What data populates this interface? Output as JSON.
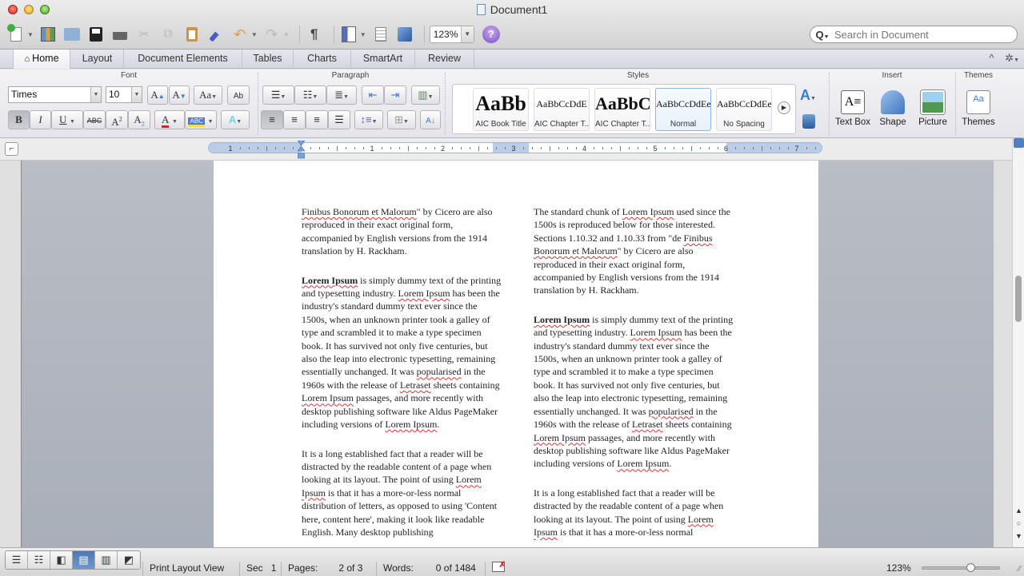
{
  "window": {
    "title": "Document1"
  },
  "toolbar": {
    "buttons": [
      "new-document",
      "templates",
      "open",
      "save",
      "print",
      "cut",
      "copy",
      "paste",
      "format-painter",
      "undo",
      "redo",
      "show-formatting",
      "sidebar",
      "gallery",
      "media-browser"
    ],
    "zoom_value": "123%",
    "help_label": "?"
  },
  "search": {
    "placeholder": "Search in Document"
  },
  "ribbon_tabs": [
    {
      "label": "Home",
      "active": true
    },
    {
      "label": "Layout",
      "active": false
    },
    {
      "label": "Document Elements",
      "active": false
    },
    {
      "label": "Tables",
      "active": false
    },
    {
      "label": "Charts",
      "active": false
    },
    {
      "label": "SmartArt",
      "active": false
    },
    {
      "label": "Review",
      "active": false
    }
  ],
  "ribbon": {
    "groups": {
      "font": "Font",
      "paragraph": "Paragraph",
      "styles": "Styles",
      "insert": "Insert",
      "themes": "Themes"
    },
    "font_name": "Times",
    "font_size": "10",
    "bold_label": "B",
    "italic_label": "I",
    "underline_label": "U",
    "strike_label": "ABC",
    "styles": [
      {
        "sample": "AaBb",
        "name": "AIC Book Title",
        "selected": false
      },
      {
        "sample": "AaBbCcDdE",
        "name": "AIC Chapter T...",
        "selected": false
      },
      {
        "sample": "AaBbC",
        "name": "AIC Chapter T...",
        "selected": false
      },
      {
        "sample": "AaBbCcDdEe",
        "name": "Normal",
        "selected": true
      },
      {
        "sample": "AaBbCcDdEe",
        "name": "No Spacing",
        "selected": false
      }
    ],
    "insert_buttons": [
      "Text Box",
      "Shape",
      "Picture"
    ],
    "themes_button": "Themes"
  },
  "ruler": {
    "numbers": [
      "1",
      "1",
      "2",
      "3",
      "4",
      "5",
      "6",
      "7"
    ]
  },
  "document": {
    "left_column": [
      {
        "segments": [
          {
            "t": "Finibus Bonorum et Malorum",
            "sp": true
          },
          {
            "t": "\" by Cicero are also reproduced in their exact original form, accompanied by English versions from the 1914 translation by H. Rackham."
          }
        ]
      },
      {
        "segments": [
          {
            "t": "Lorem Ipsum",
            "b": true,
            "sp": true
          },
          {
            "t": " is simply dummy text of the printing and typesetting industry. "
          },
          {
            "t": "Lorem Ipsum",
            "sp": true
          },
          {
            "t": " has been the industry's standard dummy text ever since the 1500s, when an unknown printer took a galley of type and scrambled it to make a type specimen book. It has survived not only five centuries, but also the leap into electronic typesetting, remaining essentially unchanged. It was "
          },
          {
            "t": "popularised",
            "sp": true
          },
          {
            "t": " in the 1960s with the release of "
          },
          {
            "t": "Letraset",
            "sp": true
          },
          {
            "t": " sheets containing "
          },
          {
            "t": "Lorem Ipsum",
            "sp": true
          },
          {
            "t": " passages, and more recently with desktop publishing software like Aldus PageMaker including versions of "
          },
          {
            "t": "Lorem Ipsum",
            "sp": true
          },
          {
            "t": "."
          }
        ]
      },
      {
        "segments": [
          {
            "t": "It is a long established fact that a reader will be distracted by the readable content of a page when looking at its layout. The point of using "
          },
          {
            "t": "Lorem Ipsum",
            "sp": true
          },
          {
            "t": " is that it has a more-or-less normal distribution of letters, as opposed to using 'Content here, content here', making it look like readable English. Many desktop publishing"
          }
        ]
      }
    ],
    "right_column": [
      {
        "segments": [
          {
            "t": "The standard chunk of "
          },
          {
            "t": "Lorem Ipsum",
            "sp": true
          },
          {
            "t": " used since the 1500s is reproduced below for those interested. Sections 1.10.32 and 1.10.33 from \"de "
          },
          {
            "t": "Finibus Bonorum et Malorum",
            "sp": true
          },
          {
            "t": "\" by Cicero are also reproduced in their exact original form, accompanied by English versions from the 1914 translation by H. Rackham."
          }
        ]
      },
      {
        "segments": [
          {
            "t": "Lorem Ipsum",
            "b": true,
            "sp": true
          },
          {
            "t": " is simply dummy text of the printing and typesetting industry. "
          },
          {
            "t": "Lorem Ipsum",
            "sp": true
          },
          {
            "t": " has been the industry's standard dummy text ever since the 1500s, when an unknown printer took a galley of type and scrambled it to make a type specimen book. It has survived not only five centuries, but also the leap into electronic typesetting, remaining essentially unchanged. It was "
          },
          {
            "t": "popularised",
            "sp": true
          },
          {
            "t": " in the 1960s with the release of "
          },
          {
            "t": "Letraset",
            "sp": true
          },
          {
            "t": " sheets containing "
          },
          {
            "t": "Lorem Ipsum",
            "sp": true
          },
          {
            "t": " passages, and more recently with desktop publishing software like Aldus PageMaker including versions of "
          },
          {
            "t": "Lorem Ipsum",
            "sp": true
          },
          {
            "t": "."
          }
        ]
      },
      {
        "segments": [
          {
            "t": "It is a long established fact that a reader will be distracted by the readable content of a page when looking at its layout. The point of using "
          },
          {
            "t": "Lorem Ipsum",
            "sp": true
          },
          {
            "t": " is that it has a more-or-less normal"
          }
        ]
      }
    ]
  },
  "statusbar": {
    "view_name": "Print Layout View",
    "sec_label": "Sec",
    "sec_value": "1",
    "pages_label": "Pages:",
    "pages_value": "2 of 3",
    "words_label": "Words:",
    "words_value": "0 of 1484",
    "zoom_percent": "123%",
    "zoom_slider_fraction": 0.62
  },
  "colors": {
    "spelling_underline": "#dd3333",
    "active_view": "#4d79b8",
    "ruler_margin": "#b9cde6"
  }
}
